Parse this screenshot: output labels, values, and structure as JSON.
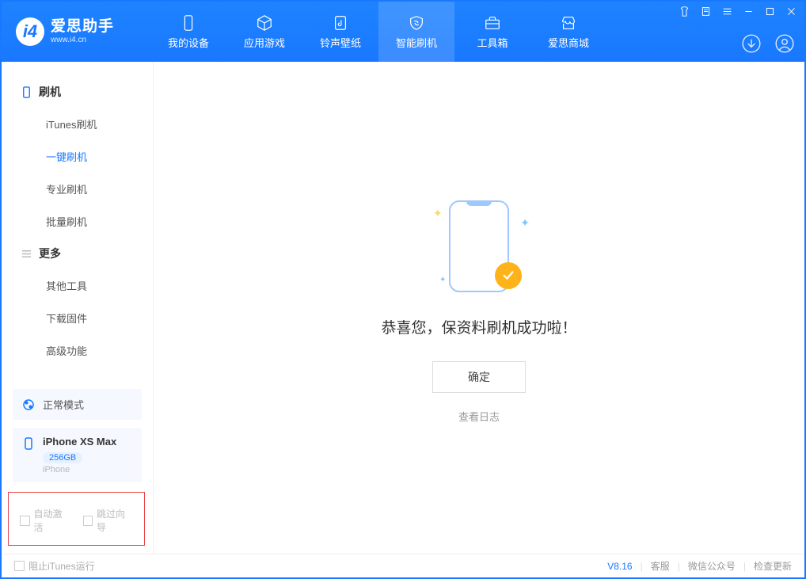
{
  "header": {
    "logo_title": "爱思助手",
    "logo_sub": "www.i4.cn",
    "nav": [
      "我的设备",
      "应用游戏",
      "铃声壁纸",
      "智能刷机",
      "工具箱",
      "爱思商城"
    ]
  },
  "sidebar": {
    "group_flash": "刷机",
    "items_flash": [
      "iTunes刷机",
      "一键刷机",
      "专业刷机",
      "批量刷机"
    ],
    "group_more": "更多",
    "items_more": [
      "其他工具",
      "下载固件",
      "高级功能"
    ],
    "mode_label": "正常模式",
    "device_name": "iPhone XS Max",
    "device_cap": "256GB",
    "device_type": "iPhone",
    "check_auto_activate": "自动激活",
    "check_skip_guide": "跳过向导"
  },
  "main": {
    "success_title": "恭喜您，保资料刷机成功啦！",
    "ok_button": "确定",
    "log_link": "查看日志"
  },
  "footer": {
    "block_itunes": "阻止iTunes运行",
    "version": "V8.16",
    "links": [
      "客服",
      "微信公众号",
      "检查更新"
    ]
  }
}
